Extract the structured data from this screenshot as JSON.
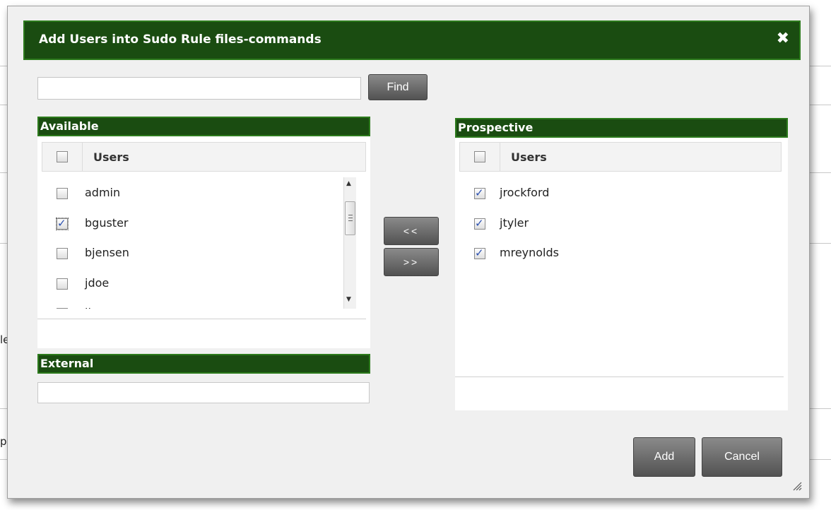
{
  "background": {
    "fragment_1": "le",
    "fragment_2": "ps"
  },
  "dialog": {
    "title": "Add Users into Sudo Rule files-commands",
    "close_label": "✖",
    "search": {
      "value": "",
      "placeholder": ""
    },
    "find_label": "Find",
    "available": {
      "header": "Available",
      "column": "Users",
      "items": [
        {
          "name": "admin",
          "checked": false
        },
        {
          "name": "bguster",
          "checked": true
        },
        {
          "name": "bjensen",
          "checked": false
        },
        {
          "name": "jdoe",
          "checked": false
        },
        {
          "name": "jjones",
          "checked": false
        }
      ]
    },
    "move_left_label": "<<",
    "move_right_label": ">>",
    "external": {
      "header": "External",
      "value": ""
    },
    "prospective": {
      "header": "Prospective",
      "column": "Users",
      "items": [
        {
          "name": "jrockford",
          "checked": true
        },
        {
          "name": "jtyler",
          "checked": true
        },
        {
          "name": "mreynolds",
          "checked": true
        }
      ]
    },
    "add_label": "Add",
    "cancel_label": "Cancel"
  },
  "colors": {
    "header_green": "#1a4c11",
    "header_border": "#2c7a1c",
    "checkmark": "#2a4fb0"
  }
}
